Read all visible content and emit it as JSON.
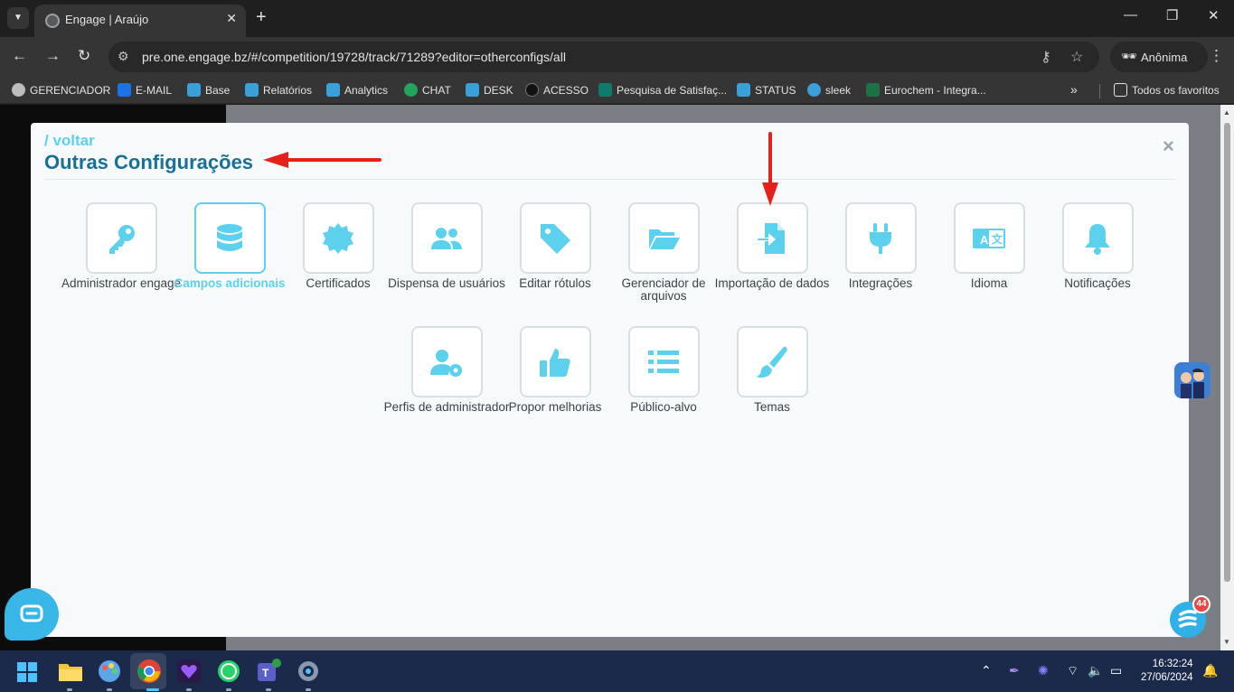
{
  "browser": {
    "tab_title": "Engage | Araújo",
    "url": "pre.one.engage.bz/#/competition/19728/track/71289?editor=otherconfigs/all",
    "profile_label": "Anônima",
    "bookmarks": [
      {
        "label": "GERENCIADOR",
        "color": "#bdbdbd"
      },
      {
        "label": "E-MAIL",
        "color": "#1a73e8"
      },
      {
        "label": "Base",
        "color": "#3aa0d8"
      },
      {
        "label": "Relatórios",
        "color": "#3aa0d8"
      },
      {
        "label": "Analytics",
        "color": "#3aa0d8"
      },
      {
        "label": "CHAT",
        "color": "#23a45a"
      },
      {
        "label": "DESK",
        "color": "#3aa0d8"
      },
      {
        "label": "ACESSO",
        "color": "#222222"
      },
      {
        "label": "Pesquisa de Satisfaç...",
        "color": "#0f7b6c"
      },
      {
        "label": "STATUS",
        "color": "#3aa0d8"
      },
      {
        "label": "sleek",
        "color": "#3aa0d8"
      },
      {
        "label": "Eurochem - Integra...",
        "color": "#1e7145"
      }
    ],
    "all_bookmarks_label": "Todos os favoritos"
  },
  "modal": {
    "back_label": "/ voltar",
    "title": "Outras Configurações",
    "close_label": "×"
  },
  "tiles": [
    {
      "name": "administrador-engage",
      "label": "Administrador engage",
      "icon": "key-icon",
      "active": false
    },
    {
      "name": "campos-adicionais",
      "label": "Campos adicionais",
      "icon": "database-icon",
      "active": true
    },
    {
      "name": "certificados",
      "label": "Certificados",
      "icon": "certificate-icon",
      "active": false
    },
    {
      "name": "dispensa-de-usuarios",
      "label": "Dispensa de usuários",
      "icon": "users-icon",
      "active": false
    },
    {
      "name": "editar-rotulos",
      "label": "Editar rótulos",
      "icon": "tag-icon",
      "active": false
    },
    {
      "name": "gerenciador-de-arquivos",
      "label": "Gerenciador de arquivos",
      "icon": "folder-open-icon",
      "active": false
    },
    {
      "name": "importacao-de-dados",
      "label": "Importação de dados",
      "icon": "file-import-icon",
      "active": false
    },
    {
      "name": "integracoes",
      "label": "Integrações",
      "icon": "plug-icon",
      "active": false
    },
    {
      "name": "idioma",
      "label": "Idioma",
      "icon": "language-icon",
      "active": false
    },
    {
      "name": "notificacoes",
      "label": "Notificações",
      "icon": "bell-icon",
      "active": false
    },
    {
      "name": "perfis-de-administrador",
      "label": "Perfis de administrador",
      "icon": "user-gear-icon",
      "active": false
    },
    {
      "name": "propor-melhorias",
      "label": "Propor melhorias",
      "icon": "thumbs-up-icon",
      "active": false
    },
    {
      "name": "publico-alvo",
      "label": "Público-alvo",
      "icon": "list-icon",
      "active": false
    },
    {
      "name": "temas",
      "label": "Temas",
      "icon": "paint-brush-icon",
      "active": false
    }
  ],
  "widgets": {
    "notification_count": "44"
  },
  "taskbar": {
    "time": "16:32:24",
    "date": "27/06/2024"
  },
  "colors": {
    "accent": "#5bd1ee",
    "title": "#1c6f94",
    "annotation_arrow": "#e8201b"
  }
}
